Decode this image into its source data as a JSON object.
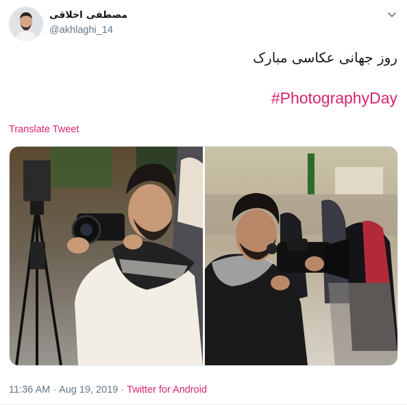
{
  "author": {
    "display_name": "مصطفی اخلاقی",
    "handle": "@akhlaghi_14"
  },
  "tweet": {
    "text": "روز جهانی عکاسی مبارک",
    "hashtag": "#PhotographyDay",
    "translate_label": "Translate Tweet"
  },
  "meta": {
    "time": "11:36 AM",
    "separator": "·",
    "date": "Aug 19, 2019",
    "source": "Twitter for Android"
  },
  "media": {
    "photos": [
      {
        "description_icon": "photographer-with-dslr"
      },
      {
        "description_icon": "photographer-with-video-camera"
      }
    ]
  },
  "colors": {
    "accent": "#d6246e",
    "muted": "#657786",
    "text": "#14171a"
  }
}
